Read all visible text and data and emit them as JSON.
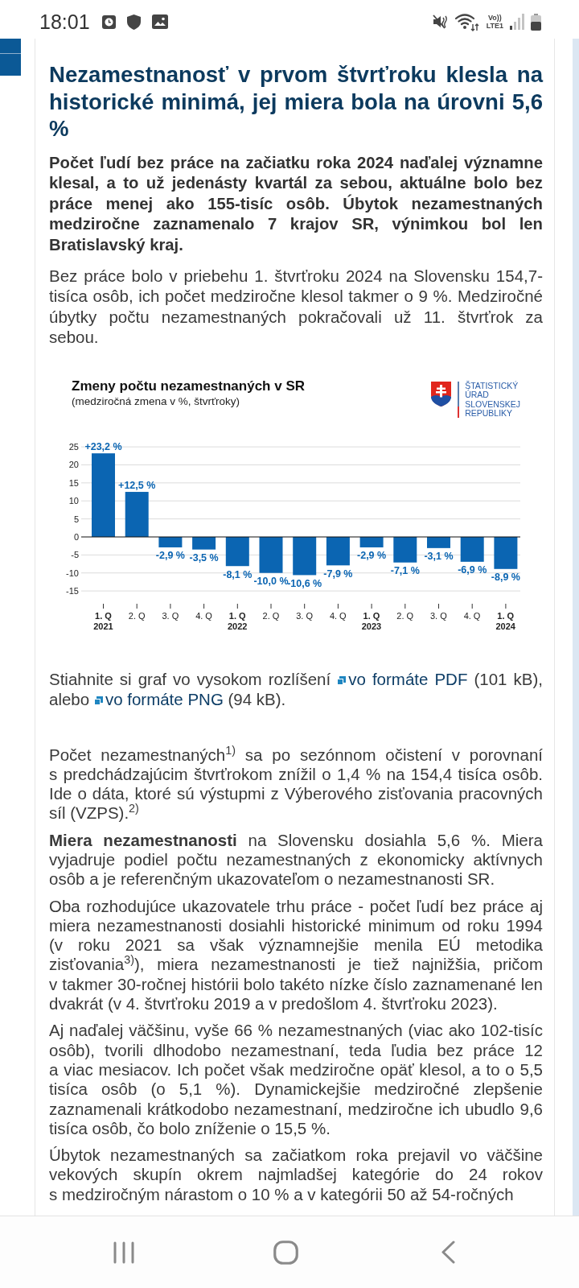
{
  "status_bar": {
    "time": "18:01",
    "network_labels": [
      "Vo))",
      "LTE1"
    ]
  },
  "article": {
    "title": "Nezamestnanosť v prvom štvrťroku klesla na historické minimá, jej miera bola na úrovni 5,6 %",
    "lead": "Počet ľudí bez práce na začiatku roka 2024 naďalej významne klesal, a to už jedenásty kvartál za sebou, aktuálne bolo bez práce menej ako 155-tisíc osôb. Úbytok nezamestnaných medziročne zaznamenalo 7 krajov SR, výnimkou bol len Bratislavský kraj.",
    "intro": "Bez práce bolo v priebehu 1. štvrťroku 2024 na Slovensku 154,7-tisíca osôb, ich počet medziročne klesol takmer o 9 %. Medziročné úbytky počtu nezamestnaných pokračovali už 11. štvrťrok za sebou.",
    "chart": {
      "subtitle": "(medziročná zmena v %, štvrťroky)",
      "logo_lines": [
        "ŠTATISTICKÝ",
        "ÚRAD",
        "SLOVENSKEJ",
        "REPUBLIKY"
      ],
      "category_bold": [
        true,
        false,
        false,
        false,
        true,
        false,
        false,
        false,
        true,
        false,
        false,
        false,
        true
      ],
      "chart_data": {
        "type": "bar",
        "title": "Zmeny počtu nezamestnaných v SR",
        "categories": [
          "1. Q 2021",
          "2. Q",
          "3. Q",
          "4. Q",
          "1. Q 2022",
          "2. Q",
          "3. Q",
          "4. Q",
          "1. Q 2023",
          "2. Q",
          "3. Q",
          "4. Q",
          "1. Q 2024"
        ],
        "values": [
          23.2,
          12.5,
          -2.9,
          -3.5,
          -8.1,
          -10.0,
          -10.6,
          -7.9,
          -2.9,
          -7.1,
          -3.1,
          -6.9,
          -8.9
        ],
        "ylim": [
          -15,
          25
        ],
        "yticks": [
          25,
          20,
          15,
          10,
          5,
          0,
          -5,
          -10,
          -15
        ],
        "grid": true,
        "value_labels": [
          "+23,2 %",
          "+12,5 %",
          "-2,9 %",
          "-3,5 %",
          "-8,1 %",
          "-10,0 %",
          "-10,6 %",
          "-7,9 %",
          "-2,9 %",
          "-7,1 %",
          "-3,1 %",
          "-6,9 %",
          "-8,9 %"
        ]
      }
    },
    "download": [
      {
        "kind": "text",
        "text": "Stiahnite si graf vo vysokom rozlíšení"
      },
      {
        "kind": "link",
        "text": "vo formáte PDF"
      },
      {
        "kind": "text",
        "text": "(101 kB), alebo"
      },
      {
        "kind": "link",
        "text": "vo formáte PNG"
      },
      {
        "kind": "text",
        "text": "(94 kB)."
      }
    ],
    "paragraphs": [
      "Počet nezamestnaných$^{1)}$ sa po sezónnom očistení v porovnaní s predchádzajúcim štvrťrokom znížil o 1,4 % na 154,4 tisíca osôb. Ide o dáta, ktoré sú výstupmi z Výberového zisťovania pracovných síl (VZPS).$^{2)}$",
      "**Miera nezamestnanosti** na Slovensku dosiahla 5,6 %. Miera vyjadruje podiel počtu nezamestnaných z ekonomicky aktívnych osôb a je referenčným ukazovateľom o nezamestnanosti SR.",
      "Oba rozhodujúce ukazovatele trhu práce - počet ľudí bez práce aj miera nezamestnanosti dosiahli historické minimum od roku 1994 (v roku 2021 sa však významnejšie menila EÚ metodika zisťovania$^{3)}$), miera nezamestnanosti je tiež najnižšia, pričom v takmer 30-ročnej histórii bolo takéto nízke číslo zaznamenané len dvakrát (v 4. štvrťroku 2019 a v predošlom 4. štvrťroku 2023).",
      "Aj naďalej väčšinu, vyše 66 % nezamestnaných (viac ako 102-tisíc osôb), tvorili dlhodobo nezamestnaní, teda ľudia bez práce 12 a viac mesiacov. Ich počet však medziročne opäť klesol, a to o 5,5 tisíca osôb (o 5,1 %). Dynamickejšie medziročné zlepšenie zaznamenali krátkodobo nezamestnaní, medziročne ich ubudlo 9,6 tisíca osôb, čo bolo zníženie o 15,5 %.",
      "Úbytok nezamestnaných sa začiatkom roka prejavil vo väčšine vekových skupín okrem najmladšej kategórie do 24 rokov s medziročným nárastom o 10 % a v kategórii 50 až 54-ročných"
    ]
  }
}
